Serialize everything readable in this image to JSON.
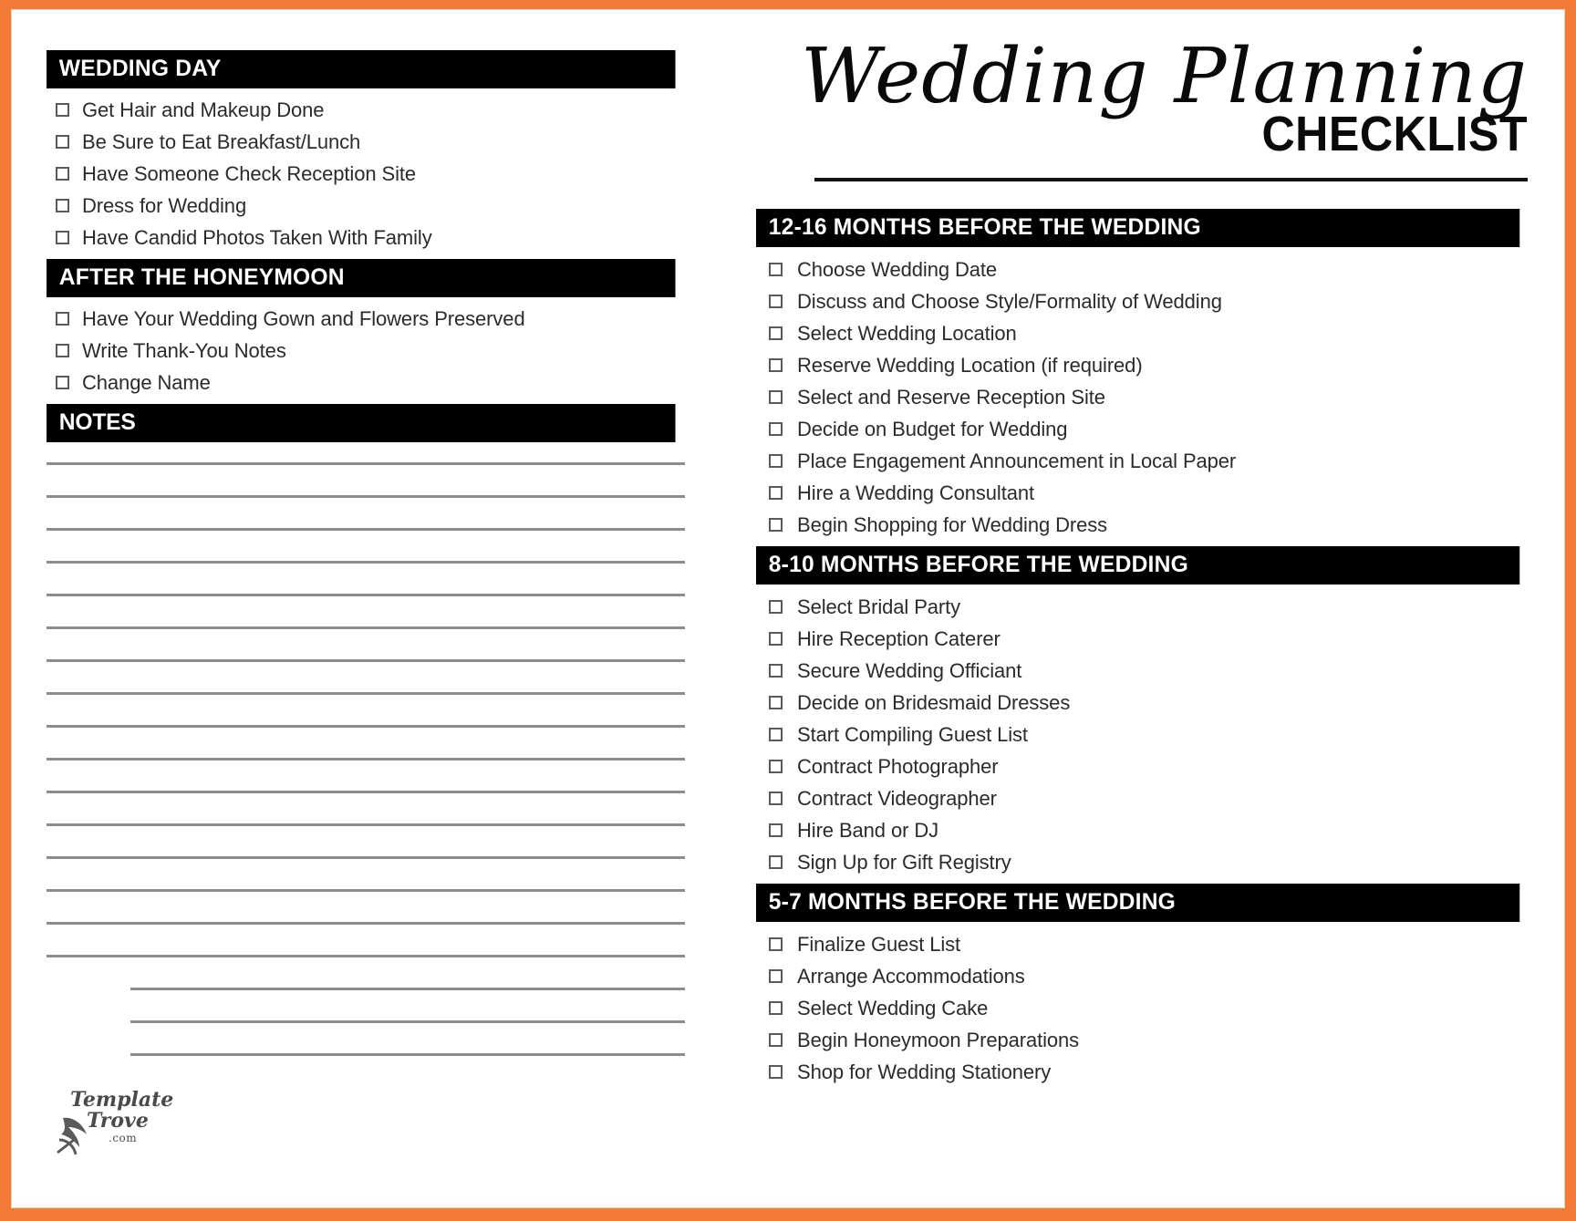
{
  "frame": {
    "border_color": "#F47B35",
    "page_color": "#ffffff"
  },
  "masthead": {
    "script_line": "Wedding Planning",
    "block_line": "CHECKLIST"
  },
  "left_column": {
    "sections": [
      {
        "heading": "WEDDING DAY",
        "items": [
          "Get Hair and Makeup Done",
          "Be Sure to Eat Breakfast/Lunch",
          "Have Someone Check Reception Site",
          "Dress for Wedding",
          "Have Candid Photos Taken With Family"
        ]
      },
      {
        "heading": "AFTER THE HONEYMOON",
        "items": [
          "Have Your Wedding Gown and Flowers Preserved",
          "Write Thank-You Notes",
          "Change Name"
        ]
      }
    ],
    "notes": {
      "heading": "NOTES",
      "line_count": 19
    }
  },
  "right_column": {
    "sections": [
      {
        "heading": "12-16 MONTHS BEFORE THE WEDDING",
        "items": [
          "Choose Wedding Date",
          "Discuss and Choose Style/Formality of Wedding",
          "Select Wedding Location",
          "Reserve Wedding Location (if required)",
          "Select and Reserve Reception Site",
          "Decide on Budget for Wedding",
          "Place Engagement Announcement in Local Paper",
          "Hire a Wedding Consultant",
          "Begin Shopping for Wedding Dress"
        ]
      },
      {
        "heading": "8-10 MONTHS BEFORE THE WEDDING",
        "items": [
          "Select Bridal Party",
          "Hire Reception Caterer",
          "Secure Wedding Officiant",
          "Decide on Bridesmaid Dresses",
          "Start Compiling Guest List",
          "Contract Photographer",
          "Contract Videographer",
          "Hire Band or DJ",
          "Sign Up for Gift Registry"
        ]
      },
      {
        "heading": "5-7 MONTHS BEFORE THE WEDDING",
        "items": [
          "Finalize Guest List",
          "Arrange Accommodations",
          "Select Wedding Cake",
          "Begin Honeymoon Preparations",
          "Shop for Wedding Stationery"
        ]
      }
    ]
  },
  "logo": {
    "word_one": "Template",
    "word_two": "Trove",
    "suffix": ".com"
  }
}
